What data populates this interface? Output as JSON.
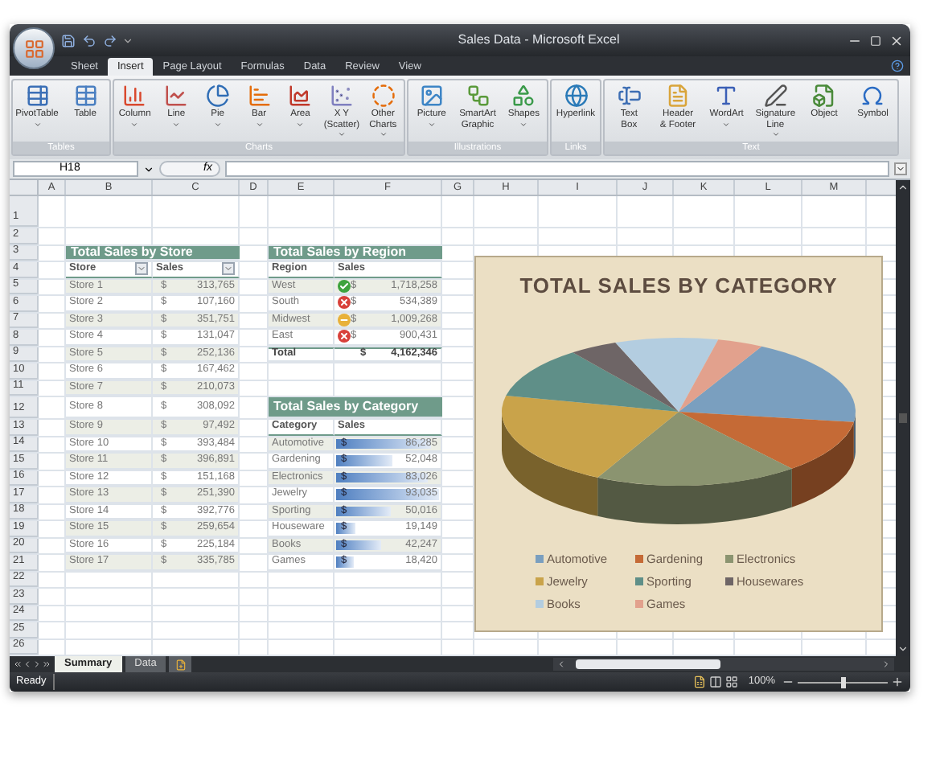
{
  "window": {
    "title": "Sales Data - Microsoft Excel"
  },
  "ribbon_tabs": [
    {
      "label": "Sheet",
      "selected": false
    },
    {
      "label": "Insert",
      "selected": true
    },
    {
      "label": "Page Layout",
      "selected": false
    },
    {
      "label": "Formulas",
      "selected": false
    },
    {
      "label": "Data",
      "selected": false
    },
    {
      "label": "Review",
      "selected": false
    },
    {
      "label": "View",
      "selected": false
    }
  ],
  "ribbon_groups": [
    {
      "label": "Tables",
      "buttons": [
        {
          "label": "PivotTable",
          "has_menu": true
        },
        {
          "label": "Table",
          "has_menu": false
        }
      ]
    },
    {
      "label": "Charts",
      "buttons": [
        {
          "label": "Column",
          "has_menu": true
        },
        {
          "label": "Line",
          "has_menu": true
        },
        {
          "label": "Pie",
          "has_menu": true
        },
        {
          "label": "Bar",
          "has_menu": true
        },
        {
          "label": "Area",
          "has_menu": true
        },
        {
          "label": "X Y\n(Scatter)",
          "has_menu": true
        },
        {
          "label": "Other\nCharts",
          "has_menu": true
        }
      ]
    },
    {
      "label": "Illustrations",
      "buttons": [
        {
          "label": "Picture",
          "has_menu": true
        },
        {
          "label": "SmartArt\nGraphic",
          "has_menu": false
        },
        {
          "label": "Shapes",
          "has_menu": true
        }
      ]
    },
    {
      "label": "Links",
      "buttons": [
        {
          "label": "Hyperlink",
          "has_menu": false
        }
      ]
    },
    {
      "label": "Text",
      "buttons": [
        {
          "label": "Text\nBox",
          "has_menu": false
        },
        {
          "label": "Header\n& Footer",
          "has_menu": false
        },
        {
          "label": "WordArt",
          "has_menu": true
        },
        {
          "label": "Signature\nLine",
          "has_menu": true
        },
        {
          "label": "Object",
          "has_menu": false
        },
        {
          "label": "Symbol",
          "has_menu": false
        }
      ]
    }
  ],
  "formula_bar": {
    "name_box": "H18",
    "function_label": "fx"
  },
  "column_headers": [
    "A",
    "B",
    "C",
    "D",
    "E",
    "F",
    "G",
    "H",
    "I",
    "J",
    "K",
    "L",
    "M"
  ],
  "row_headers": [
    "1",
    "2",
    "3",
    "4",
    "5",
    "6",
    "7",
    "8",
    "9",
    "10",
    "11",
    "12",
    "13",
    "14",
    "15",
    "16",
    "17",
    "18",
    "19",
    "20",
    "21",
    "22",
    "23",
    "24",
    "25",
    "26"
  ],
  "store_table": {
    "title": "Total Sales by Store",
    "columns": [
      {
        "label": "Store",
        "filter": true
      },
      {
        "label": "Sales",
        "filter": true
      }
    ],
    "rows": [
      {
        "store": "Store 1",
        "currency": "$",
        "sales": "313,765"
      },
      {
        "store": "Store 2",
        "currency": "$",
        "sales": "107,160"
      },
      {
        "store": "Store 3",
        "currency": "$",
        "sales": "351,751"
      },
      {
        "store": "Store 4",
        "currency": "$",
        "sales": "131,047"
      },
      {
        "store": "Store 5",
        "currency": "$",
        "sales": "252,136"
      },
      {
        "store": "Store 6",
        "currency": "$",
        "sales": "167,462"
      },
      {
        "store": "Store 7",
        "currency": "$",
        "sales": "210,073"
      },
      {
        "store": "Store 8",
        "currency": "$",
        "sales": "308,092"
      },
      {
        "store": "Store 9",
        "currency": "$",
        "sales": "97,492"
      },
      {
        "store": "Store 10",
        "currency": "$",
        "sales": "393,484"
      },
      {
        "store": "Store 11",
        "currency": "$",
        "sales": "396,891"
      },
      {
        "store": "Store 12",
        "currency": "$",
        "sales": "151,168"
      },
      {
        "store": "Store 13",
        "currency": "$",
        "sales": "251,390"
      },
      {
        "store": "Store 14",
        "currency": "$",
        "sales": "392,776"
      },
      {
        "store": "Store 15",
        "currency": "$",
        "sales": "259,654"
      },
      {
        "store": "Store 16",
        "currency": "$",
        "sales": "225,184"
      },
      {
        "store": "Store 17",
        "currency": "$",
        "sales": "335,785"
      }
    ]
  },
  "region_table": {
    "title": "Total Sales by Region",
    "columns": [
      {
        "label": "Region"
      },
      {
        "label": "Sales"
      }
    ],
    "rows": [
      {
        "region": "West",
        "color": "#3ea33e",
        "currency": "$",
        "sales": "1,718,258"
      },
      {
        "region": "South",
        "color": "#d8403a",
        "currency": "$",
        "sales": "534,389"
      },
      {
        "region": "Midwest",
        "color": "#e8b13a",
        "currency": "$",
        "sales": "1,009,268"
      },
      {
        "region": "East",
        "color": "#d8403a",
        "currency": "$",
        "sales": "900,431"
      }
    ],
    "total": {
      "label": "Total",
      "currency": "$",
      "value": "4,162,346"
    }
  },
  "category_table": {
    "title": "Total Sales by Category",
    "columns": [
      {
        "label": "Category"
      },
      {
        "label": "Sales"
      }
    ],
    "rows": [
      {
        "category": "Automotive",
        "currency": "$",
        "sales": "86,285",
        "level": 0.93
      },
      {
        "category": "Gardening",
        "currency": "$",
        "sales": "52,048",
        "level": 0.56
      },
      {
        "category": "Electronics",
        "currency": "$",
        "sales": "83,026",
        "level": 0.89
      },
      {
        "category": "Jewelry",
        "currency": "$",
        "sales": "93,035",
        "level": 1.0
      },
      {
        "category": "Sporting",
        "currency": "$",
        "sales": "50,016",
        "level": 0.54
      },
      {
        "category": "Houseware",
        "currency": "$",
        "sales": "19,149",
        "level": 0.21
      },
      {
        "category": "Books",
        "currency": "$",
        "sales": "42,247",
        "level": 0.45
      },
      {
        "category": "Games",
        "currency": "$",
        "sales": "18,420",
        "level": 0.2
      }
    ]
  },
  "chart": {
    "title": "TOTAL SALES BY CATEGORY",
    "legend": [
      {
        "label": "Automotive",
        "color": "#7a9fbf"
      },
      {
        "label": "Gardening",
        "color": "#c56a36"
      },
      {
        "label": "Electronics",
        "color": "#8b9470"
      },
      {
        "label": "Jewelry",
        "color": "#c9a34a"
      },
      {
        "label": "Sporting",
        "color": "#5f8f88"
      },
      {
        "label": "Housewares",
        "color": "#6e6566"
      },
      {
        "label": "Books",
        "color": "#b3cde0"
      },
      {
        "label": "Games",
        "color": "#e2a18d"
      }
    ]
  },
  "sheet_tabs": [
    {
      "label": "Summary",
      "selected": true
    },
    {
      "label": "Data",
      "selected": false
    }
  ],
  "status_bar": {
    "mode": "Ready",
    "zoom": "100%",
    "zoom_slider": {
      "level": 0.5
    }
  }
}
